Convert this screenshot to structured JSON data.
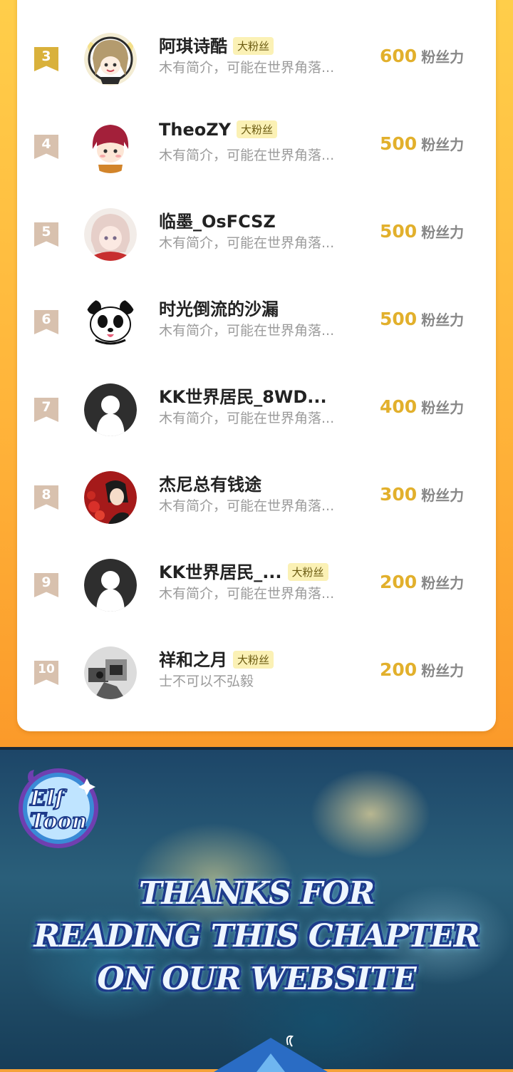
{
  "leaderboard": {
    "unit_label": "粉丝力",
    "rows": [
      {
        "rank": "3",
        "name": "阿琪诗酷",
        "tag": "大粉丝",
        "bio": "木有简介，可能在世界角落...",
        "score": "600"
      },
      {
        "rank": "4",
        "name": "TheoZY",
        "tag": "大粉丝",
        "bio": "木有简介，可能在世界角落...",
        "score": "500"
      },
      {
        "rank": "5",
        "name": "临墨_OsFCSZ",
        "tag": "",
        "bio": "木有简介，可能在世界角落...",
        "score": "500"
      },
      {
        "rank": "6",
        "name": "时光倒流的沙漏",
        "tag": "",
        "bio": "木有简介，可能在世界角落...",
        "score": "500"
      },
      {
        "rank": "7",
        "name": "KK世界居民_8WD...",
        "tag": "",
        "bio": "木有简介，可能在世界角落...",
        "score": "400"
      },
      {
        "rank": "8",
        "name": "杰尼总有钱途",
        "tag": "",
        "bio": "木有简介，可能在世界角落...",
        "score": "300"
      },
      {
        "rank": "9",
        "name": "KK世界居民_...",
        "tag": "大粉丝",
        "bio": "木有简介，可能在世界角落...",
        "score": "200"
      },
      {
        "rank": "10",
        "name": "祥和之月",
        "tag": "大粉丝",
        "bio": "士不可以不弘毅",
        "score": "200"
      }
    ]
  },
  "banner": {
    "logo_line1": "Elf",
    "logo_line2": "Toon",
    "thanks_line1": "THANKS FOR",
    "thanks_line2": "READING THIS CHAPTER",
    "thanks_line3": "ON OUR WEBSITE"
  },
  "colors": {
    "gold_rank": "#d9b13b",
    "plain_rank": "#d8c1ae",
    "score": "#e2b02c",
    "tag_bg": "#fbf1b5",
    "section_bg": "#ffb43a"
  }
}
